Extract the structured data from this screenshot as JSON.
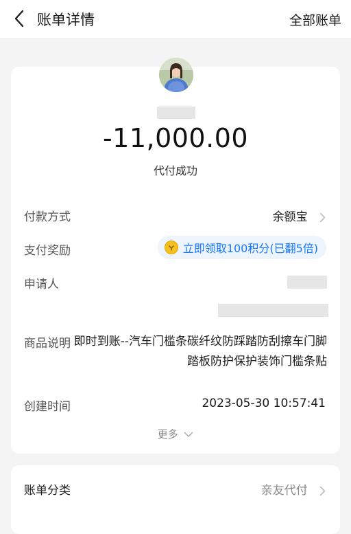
{
  "header": {
    "back_icon": "chevron-left-icon",
    "title": "账单详情",
    "right_link": "全部账单"
  },
  "summary": {
    "amount": "-11,000.00",
    "status": "代付成功"
  },
  "details": {
    "payment_method_label": "付款方式",
    "payment_method_value": "余额宝",
    "reward_label": "支付奖励",
    "reward_value": "立即领取100积分(已翻5倍)",
    "applicant_label": "申请人",
    "product_label": "商品说明",
    "product_value": "即时到账--汽车门槛条碳纤纹防踩踏防刮擦车门脚踏板防护保护装饰门槛条贴",
    "created_label": "创建时间",
    "created_value": "2023-05-30 10:57:41",
    "more_label": "更多"
  },
  "category": {
    "label": "账单分类",
    "value": "亲友代付"
  },
  "colors": {
    "accent": "#1677ff",
    "page_bg": "#f4f4f4",
    "card_bg": "#ffffff",
    "coin": "#f5c020"
  }
}
